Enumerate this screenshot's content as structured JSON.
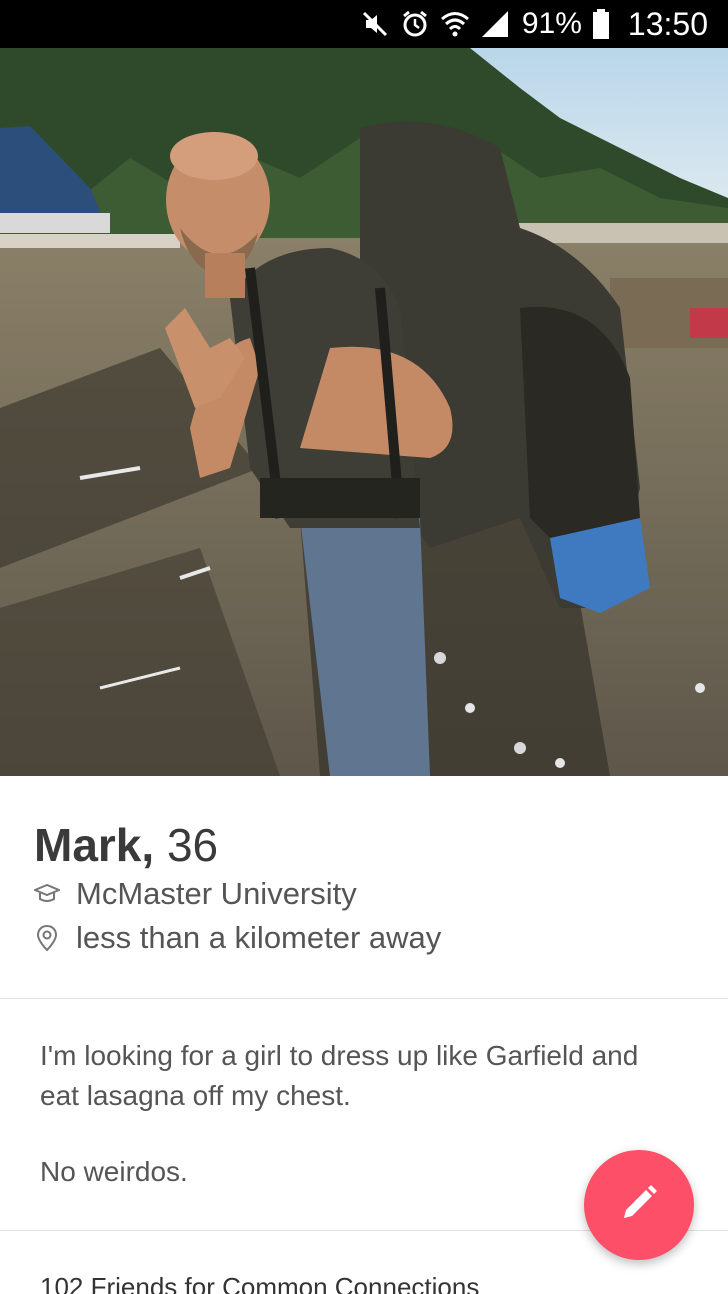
{
  "status_bar": {
    "battery_percent": "91%",
    "time": "13:50",
    "icons": [
      "mute-icon",
      "alarm-icon",
      "wifi-icon",
      "signal-icon",
      "battery-icon"
    ]
  },
  "profile": {
    "name": "Mark,",
    "age": "36",
    "school": "McMaster University",
    "school_icon": "graduation-cap-icon",
    "distance": "less than a kilometer away",
    "distance_icon": "location-pin-icon"
  },
  "bio": {
    "line1": "I'm looking for a girl to dress up like Garfield and eat lasagna off my chest.",
    "line2": "No weirdos."
  },
  "friends": {
    "title": "102 Friends for Common Connections"
  },
  "fab": {
    "icon": "edit-pencil-icon",
    "color": "#fd5068"
  },
  "colors": {
    "accent": "#fd5068",
    "text_primary": "#3a3a3a",
    "text_secondary": "#555555"
  }
}
